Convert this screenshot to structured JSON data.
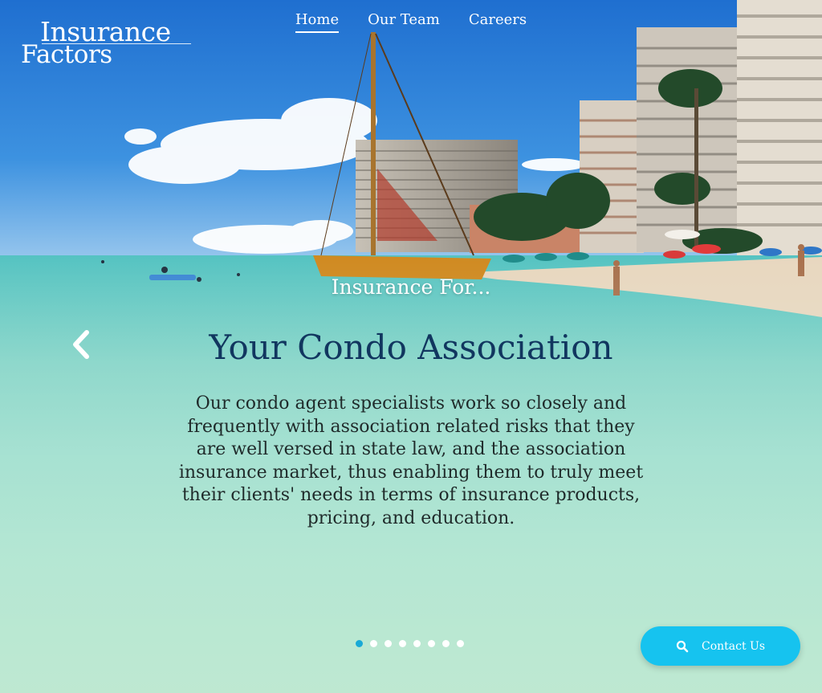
{
  "header": {
    "logo_line1": "Insurance",
    "logo_line2": "Factors",
    "nav": [
      {
        "label": "Home",
        "active": true
      },
      {
        "label": "Our Team",
        "active": false
      },
      {
        "label": "Careers",
        "active": false
      }
    ]
  },
  "hero": {
    "kicker": "Insurance For...",
    "headline": "Your Condo Association",
    "body": "Our condo agent specialists work so closely and frequently with association related risks that they are well versed in state law, and the association insurance market, thus enabling them to truly meet their clients' needs in terms of insurance products, pricing, and education."
  },
  "carousel": {
    "prev_icon": "chevron-left-icon",
    "slide_count": 8,
    "active_index": 0
  },
  "contact_button": {
    "label": "Contact Us",
    "icon": "search-icon"
  },
  "colors": {
    "headline": "#11365f",
    "button": "#16c3ef",
    "active_dot": "#19a9d6"
  }
}
